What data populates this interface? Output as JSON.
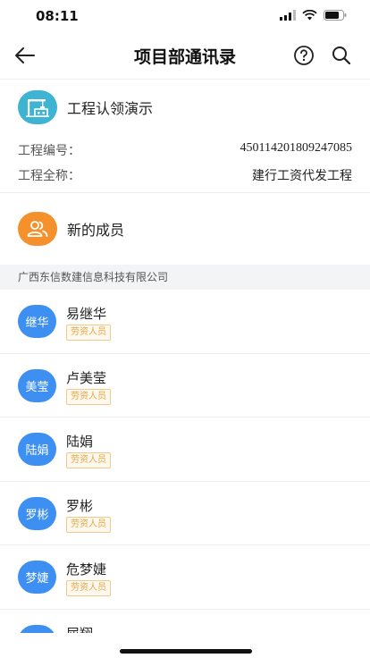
{
  "status_bar": {
    "time": "08:11"
  },
  "nav": {
    "title": "项目部通讯录"
  },
  "project": {
    "name": "工程认领演示",
    "fields": [
      {
        "label": "工程编号：",
        "value": "450114201809247085"
      },
      {
        "label": "工程全称：",
        "value": "建行工资代发工程"
      }
    ]
  },
  "new_member": {
    "label": "新的成员"
  },
  "company": {
    "name": "广西东信数建信息科技有限公司"
  },
  "members": [
    {
      "avatar_text": "继华",
      "name": "易继华",
      "tag": "劳资人员"
    },
    {
      "avatar_text": "美莹",
      "name": "卢美莹",
      "tag": "劳资人员"
    },
    {
      "avatar_text": "陆娟",
      "name": "陆娟",
      "tag": "劳资人员"
    },
    {
      "avatar_text": "罗彬",
      "name": "罗彬",
      "tag": "劳资人员"
    },
    {
      "avatar_text": "梦婕",
      "name": "危梦婕",
      "tag": "劳资人员"
    },
    {
      "avatar_text": "",
      "name": "屈翔",
      "tag": ""
    }
  ],
  "colors": {
    "avatar": "#3d8ff2",
    "project_icon": "#3fb3d2",
    "new_member_icon": "#f5912d",
    "tag_text": "#e5a74b"
  }
}
